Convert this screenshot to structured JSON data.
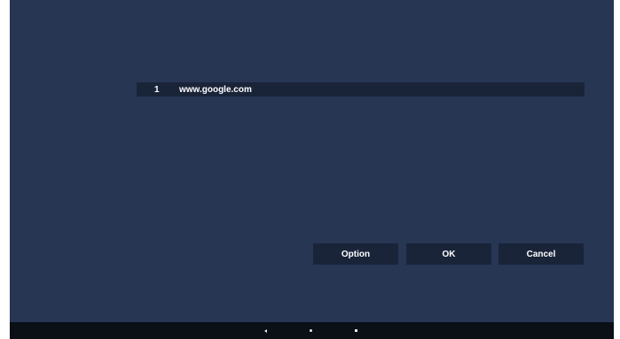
{
  "list": {
    "items": [
      {
        "index": "1",
        "url": "www.google.com"
      }
    ]
  },
  "buttons": {
    "option": "Option",
    "ok": "OK",
    "cancel": "Cancel"
  },
  "navbar": {
    "back_icon": "back-triangle-icon",
    "home_icon": "home-dot-icon",
    "recent_icon": "recent-apps-square-icon"
  },
  "colors": {
    "background": "#263653",
    "row_background": "#1a2439",
    "button_background": "#1a2439",
    "navbar_background": "#0b0f16",
    "text": "#ffffff"
  }
}
